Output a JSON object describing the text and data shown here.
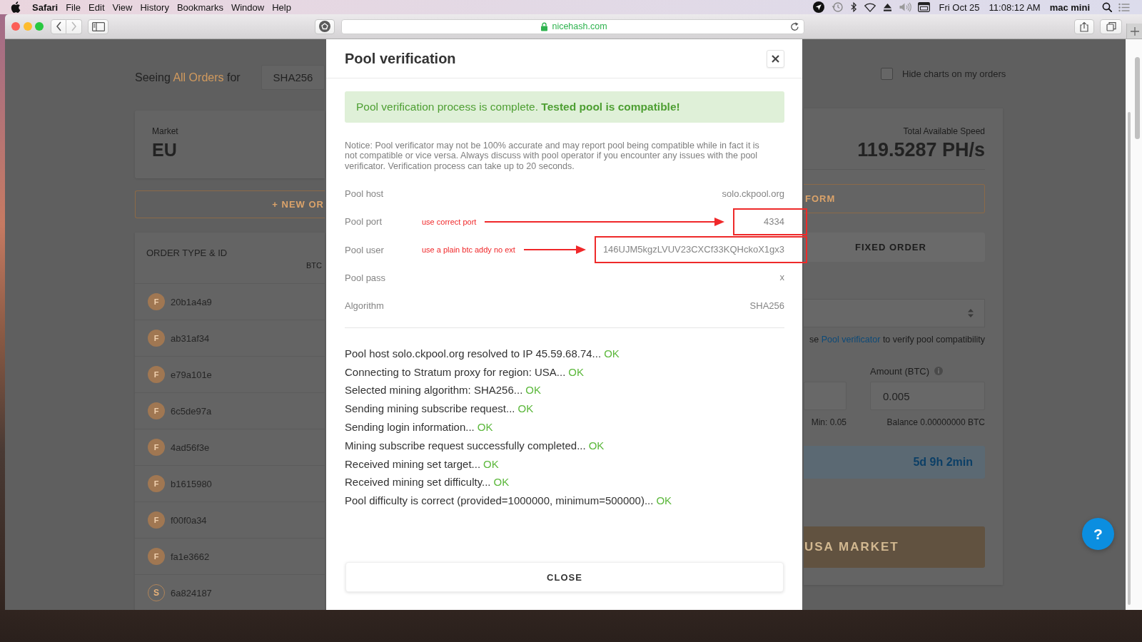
{
  "menu_bar": {
    "app": "Safari",
    "menus": [
      "File",
      "Edit",
      "View",
      "History",
      "Bookmarks",
      "Window",
      "Help"
    ],
    "date": "Fri Oct 25",
    "time": "11:08:12 AM",
    "user": "mac mini"
  },
  "browser": {
    "url": "nicehash.com",
    "secure": true
  },
  "page": {
    "heading": {
      "prefix": "Seeing",
      "filter": "All Orders",
      "suffix": "for"
    },
    "algorithm": "SHA256",
    "hide_charts": {
      "label": "Hide charts on my orders",
      "checked": false
    },
    "market": {
      "label": "Market",
      "value": "EU"
    },
    "new_order_button": "+ NEW OR",
    "orders": {
      "column": "ORDER TYPE & ID",
      "column_2": "BTC",
      "rows": [
        {
          "kind": "fixed",
          "badge": "F",
          "id": "20b1a4a9"
        },
        {
          "kind": "fixed",
          "badge": "F",
          "id": "ab31af34"
        },
        {
          "kind": "fixed",
          "badge": "F",
          "id": "e79a101e"
        },
        {
          "kind": "fixed",
          "badge": "F",
          "id": "6c5de97a"
        },
        {
          "kind": "fixed",
          "badge": "F",
          "id": "4ad56f3e"
        },
        {
          "kind": "fixed",
          "badge": "F",
          "id": "b1615980"
        },
        {
          "kind": "fixed",
          "badge": "F",
          "id": "f00f0a34"
        },
        {
          "kind": "fixed",
          "badge": "F",
          "id": "fa1e3662"
        },
        {
          "kind": "standard",
          "badge": "S",
          "id": "6a824187"
        }
      ]
    },
    "speed": {
      "label": "Total Available Speed",
      "value": "119.5287 PH/s"
    },
    "form_button": "FORM",
    "order_tab": "FIXED ORDER",
    "verificator_hint": {
      "before": "se",
      "link": "Pool verificator",
      "after": "to verify pool compatibility"
    },
    "amount": {
      "label": "Amount (BTC)",
      "value": "0.005",
      "balance": "Balance 0.00000000 BTC"
    },
    "min_note": "Min: 0.05",
    "duration": "5d 9h 2min",
    "submit_button": "USA MARKET",
    "help_button": "?"
  },
  "dialog": {
    "title": "Pool verification",
    "alert": "Pool verification process is complete. **Tested pool is compatible!**",
    "notice": "Notice: Pool verificator may not be 100% accurate and may report pool being compatible while in fact it is not compatible or vice versa. Always discuss with pool operator if you encounter any issues with the pool verificator. Verification process can take up to 20 seconds.",
    "fields": [
      {
        "label": "Pool host",
        "value": "solo.ckpool.org"
      },
      {
        "label": "Pool port",
        "value": "4334",
        "note": "use correct port"
      },
      {
        "label": "Pool user",
        "value": "146UJM5kgzLVUV23CXCf33KQHckoX1gx3",
        "note": "use a plain btc addy no ext"
      },
      {
        "label": "Pool pass",
        "value": "x"
      },
      {
        "label": "Algorithm",
        "value": "SHA256"
      }
    ],
    "log": [
      {
        "text": "Pool host solo.ckpool.org resolved to IP 45.59.68.74...",
        "result": "OK"
      },
      {
        "text": "Connecting to Stratum proxy for region: USA...",
        "result": "OK"
      },
      {
        "text": "Selected mining algorithm: SHA256...",
        "result": "OK"
      },
      {
        "text": "Sending mining subscribe request...",
        "result": "OK"
      },
      {
        "text": "Sending login information...",
        "result": "OK"
      },
      {
        "text": "Mining subscribe request successfully completed...",
        "result": "OK"
      },
      {
        "text": "Received mining set target...",
        "result": "OK"
      },
      {
        "text": "Received mining set difficulty...",
        "result": "OK"
      },
      {
        "text": "Pool difficulty is correct (provided=1000000, minimum=500000)...",
        "result": "OK"
      }
    ],
    "close_button": "CLOSE"
  }
}
